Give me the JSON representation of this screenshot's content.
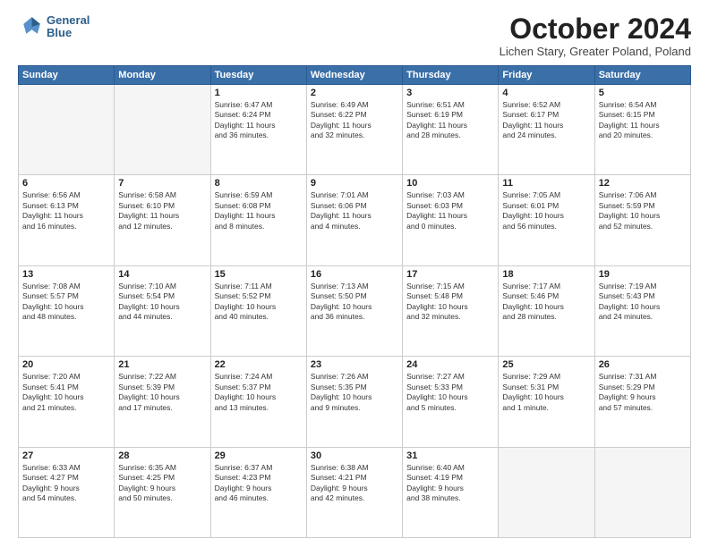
{
  "header": {
    "logo_line1": "General",
    "logo_line2": "Blue",
    "month_title": "October 2024",
    "location": "Lichen Stary, Greater Poland, Poland"
  },
  "days_of_week": [
    "Sunday",
    "Monday",
    "Tuesday",
    "Wednesday",
    "Thursday",
    "Friday",
    "Saturday"
  ],
  "weeks": [
    [
      {
        "num": "",
        "info": ""
      },
      {
        "num": "",
        "info": ""
      },
      {
        "num": "1",
        "info": "Sunrise: 6:47 AM\nSunset: 6:24 PM\nDaylight: 11 hours\nand 36 minutes."
      },
      {
        "num": "2",
        "info": "Sunrise: 6:49 AM\nSunset: 6:22 PM\nDaylight: 11 hours\nand 32 minutes."
      },
      {
        "num": "3",
        "info": "Sunrise: 6:51 AM\nSunset: 6:19 PM\nDaylight: 11 hours\nand 28 minutes."
      },
      {
        "num": "4",
        "info": "Sunrise: 6:52 AM\nSunset: 6:17 PM\nDaylight: 11 hours\nand 24 minutes."
      },
      {
        "num": "5",
        "info": "Sunrise: 6:54 AM\nSunset: 6:15 PM\nDaylight: 11 hours\nand 20 minutes."
      }
    ],
    [
      {
        "num": "6",
        "info": "Sunrise: 6:56 AM\nSunset: 6:13 PM\nDaylight: 11 hours\nand 16 minutes."
      },
      {
        "num": "7",
        "info": "Sunrise: 6:58 AM\nSunset: 6:10 PM\nDaylight: 11 hours\nand 12 minutes."
      },
      {
        "num": "8",
        "info": "Sunrise: 6:59 AM\nSunset: 6:08 PM\nDaylight: 11 hours\nand 8 minutes."
      },
      {
        "num": "9",
        "info": "Sunrise: 7:01 AM\nSunset: 6:06 PM\nDaylight: 11 hours\nand 4 minutes."
      },
      {
        "num": "10",
        "info": "Sunrise: 7:03 AM\nSunset: 6:03 PM\nDaylight: 11 hours\nand 0 minutes."
      },
      {
        "num": "11",
        "info": "Sunrise: 7:05 AM\nSunset: 6:01 PM\nDaylight: 10 hours\nand 56 minutes."
      },
      {
        "num": "12",
        "info": "Sunrise: 7:06 AM\nSunset: 5:59 PM\nDaylight: 10 hours\nand 52 minutes."
      }
    ],
    [
      {
        "num": "13",
        "info": "Sunrise: 7:08 AM\nSunset: 5:57 PM\nDaylight: 10 hours\nand 48 minutes."
      },
      {
        "num": "14",
        "info": "Sunrise: 7:10 AM\nSunset: 5:54 PM\nDaylight: 10 hours\nand 44 minutes."
      },
      {
        "num": "15",
        "info": "Sunrise: 7:11 AM\nSunset: 5:52 PM\nDaylight: 10 hours\nand 40 minutes."
      },
      {
        "num": "16",
        "info": "Sunrise: 7:13 AM\nSunset: 5:50 PM\nDaylight: 10 hours\nand 36 minutes."
      },
      {
        "num": "17",
        "info": "Sunrise: 7:15 AM\nSunset: 5:48 PM\nDaylight: 10 hours\nand 32 minutes."
      },
      {
        "num": "18",
        "info": "Sunrise: 7:17 AM\nSunset: 5:46 PM\nDaylight: 10 hours\nand 28 minutes."
      },
      {
        "num": "19",
        "info": "Sunrise: 7:19 AM\nSunset: 5:43 PM\nDaylight: 10 hours\nand 24 minutes."
      }
    ],
    [
      {
        "num": "20",
        "info": "Sunrise: 7:20 AM\nSunset: 5:41 PM\nDaylight: 10 hours\nand 21 minutes."
      },
      {
        "num": "21",
        "info": "Sunrise: 7:22 AM\nSunset: 5:39 PM\nDaylight: 10 hours\nand 17 minutes."
      },
      {
        "num": "22",
        "info": "Sunrise: 7:24 AM\nSunset: 5:37 PM\nDaylight: 10 hours\nand 13 minutes."
      },
      {
        "num": "23",
        "info": "Sunrise: 7:26 AM\nSunset: 5:35 PM\nDaylight: 10 hours\nand 9 minutes."
      },
      {
        "num": "24",
        "info": "Sunrise: 7:27 AM\nSunset: 5:33 PM\nDaylight: 10 hours\nand 5 minutes."
      },
      {
        "num": "25",
        "info": "Sunrise: 7:29 AM\nSunset: 5:31 PM\nDaylight: 10 hours\nand 1 minute."
      },
      {
        "num": "26",
        "info": "Sunrise: 7:31 AM\nSunset: 5:29 PM\nDaylight: 9 hours\nand 57 minutes."
      }
    ],
    [
      {
        "num": "27",
        "info": "Sunrise: 6:33 AM\nSunset: 4:27 PM\nDaylight: 9 hours\nand 54 minutes."
      },
      {
        "num": "28",
        "info": "Sunrise: 6:35 AM\nSunset: 4:25 PM\nDaylight: 9 hours\nand 50 minutes."
      },
      {
        "num": "29",
        "info": "Sunrise: 6:37 AM\nSunset: 4:23 PM\nDaylight: 9 hours\nand 46 minutes."
      },
      {
        "num": "30",
        "info": "Sunrise: 6:38 AM\nSunset: 4:21 PM\nDaylight: 9 hours\nand 42 minutes."
      },
      {
        "num": "31",
        "info": "Sunrise: 6:40 AM\nSunset: 4:19 PM\nDaylight: 9 hours\nand 38 minutes."
      },
      {
        "num": "",
        "info": ""
      },
      {
        "num": "",
        "info": ""
      }
    ]
  ]
}
